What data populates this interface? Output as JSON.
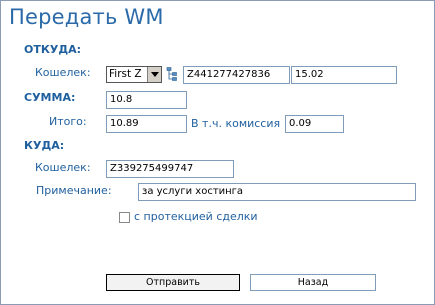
{
  "title": "Передать WM",
  "from": {
    "section_label": "ОТКУДА:",
    "wallet_label": "Кошелек:",
    "wallet_select_value": "First Z",
    "wallet_id": "Z441277427836",
    "balance": "15.02"
  },
  "amount": {
    "section_label": "СУММА:",
    "value": "10.8",
    "total_label": "Итого:",
    "total_value": "10.89",
    "commission_label": "В т.ч. комиссия",
    "commission_value": "0.09"
  },
  "to": {
    "section_label": "КУДА:",
    "wallet_label": "Кошелек:",
    "wallet_id": "Z339275499747",
    "note_label": "Примечание:",
    "note_value": "за услуги хостинга"
  },
  "protection": {
    "label": "с протекцией сделки",
    "checked": false
  },
  "buttons": {
    "send": "Отправить",
    "back": "Назад"
  }
}
